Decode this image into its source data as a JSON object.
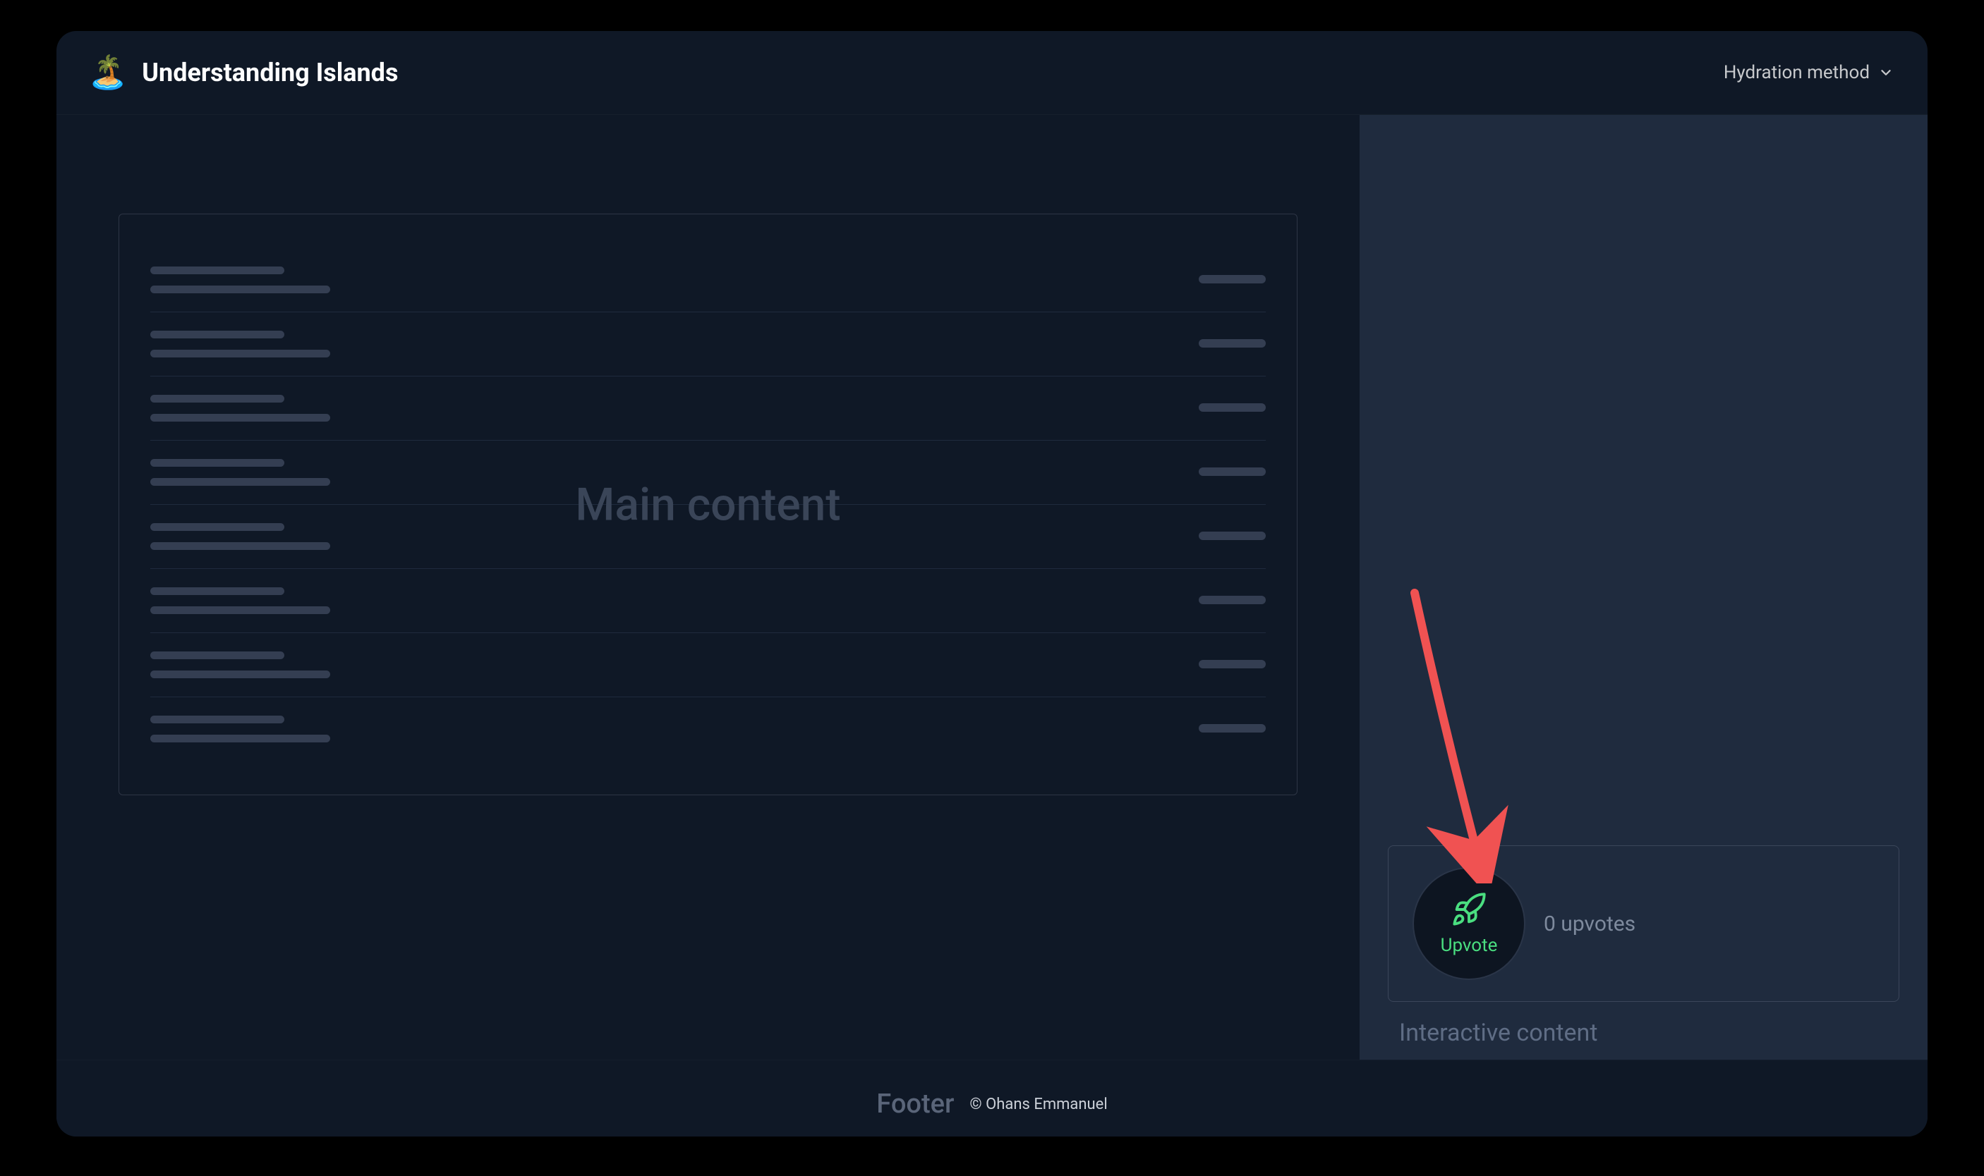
{
  "header": {
    "icon": "🏝️",
    "title": "Understanding Islands",
    "dropdown_label": "Hydration method"
  },
  "main": {
    "label": "Main content",
    "skeleton_rows": 8
  },
  "sidebar": {
    "upvote_button_label": "Upvote",
    "upvotes_text": "0 upvotes",
    "section_label": "Interactive content"
  },
  "footer": {
    "title": "Footer",
    "copyright": "© Ohans Emmanuel"
  },
  "colors": {
    "accent_green": "#4ade80",
    "arrow_red": "#f05252"
  }
}
